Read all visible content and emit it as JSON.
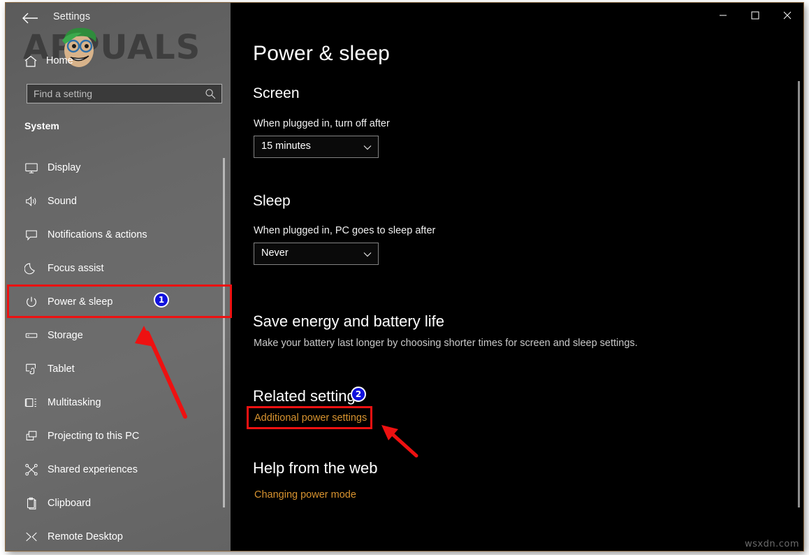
{
  "window": {
    "app_title": "Settings",
    "back_icon": "back-arrow-icon",
    "controls": {
      "minimize": "minimize-icon",
      "maximize": "maximize-icon",
      "close": "close-icon"
    }
  },
  "watermarks": {
    "top_left": "APPUALS",
    "bottom_right": "wsxdn.com"
  },
  "sidebar": {
    "home_label": "Home",
    "home_icon": "home-icon",
    "search": {
      "placeholder": "Find a setting",
      "value": "",
      "icon": "search-icon"
    },
    "group_title": "System",
    "items": [
      {
        "label": "Display",
        "icon": "monitor-icon",
        "selected": false
      },
      {
        "label": "Sound",
        "icon": "speaker-icon",
        "selected": false
      },
      {
        "label": "Notifications & actions",
        "icon": "chat-bubble-icon",
        "selected": false
      },
      {
        "label": "Focus assist",
        "icon": "moon-icon",
        "selected": false
      },
      {
        "label": "Power & sleep",
        "icon": "power-icon",
        "selected": true
      },
      {
        "label": "Storage",
        "icon": "drive-icon",
        "selected": false
      },
      {
        "label": "Tablet",
        "icon": "tablet-icon",
        "selected": false
      },
      {
        "label": "Multitasking",
        "icon": "multitasking-icon",
        "selected": false
      },
      {
        "label": "Projecting to this PC",
        "icon": "project-screen-icon",
        "selected": false
      },
      {
        "label": "Shared experiences",
        "icon": "share-nodes-icon",
        "selected": false
      },
      {
        "label": "Clipboard",
        "icon": "clipboard-icon",
        "selected": false
      },
      {
        "label": "Remote Desktop",
        "icon": "remote-desktop-icon",
        "selected": false
      }
    ]
  },
  "main": {
    "page_title": "Power & sleep",
    "screen": {
      "heading": "Screen",
      "field_label": "When plugged in, turn off after",
      "dropdown_value": "15 minutes",
      "dropdown_icon": "chevron-down-icon"
    },
    "sleep": {
      "heading": "Sleep",
      "field_label": "When plugged in, PC goes to sleep after",
      "dropdown_value": "Never",
      "dropdown_icon": "chevron-down-icon"
    },
    "save_energy": {
      "heading": "Save energy and battery life",
      "description": "Make your battery last longer by choosing shorter times for screen and sleep settings."
    },
    "related_settings": {
      "heading": "Related settings",
      "link": "Additional power settings"
    },
    "help": {
      "heading": "Help from the web",
      "link": "Changing power mode"
    }
  },
  "annotations": {
    "badge_1": "1",
    "badge_2": "2",
    "highlight_color": "#ee1111",
    "badge_color": "#1111dd",
    "link_color": "#d8932f"
  }
}
